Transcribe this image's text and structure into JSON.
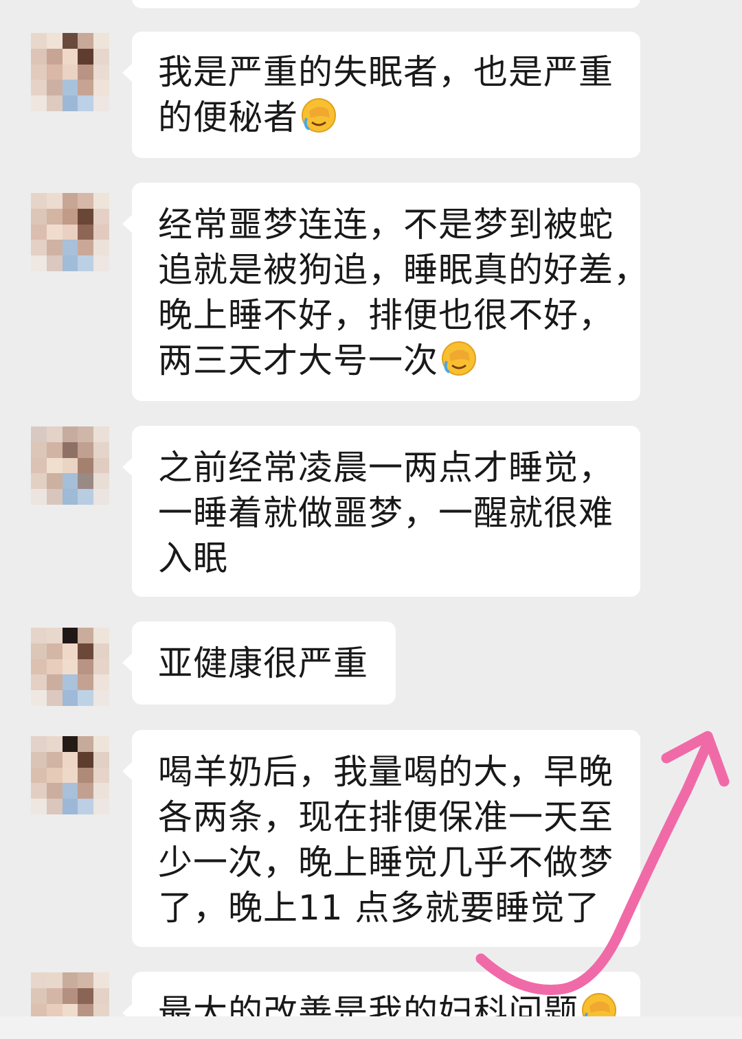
{
  "chat": {
    "messages": [
      {
        "lines": [
          "我是严重的失眠者，也是严重",
          "的便秘者"
        ],
        "emoji": "face-palm-emoji"
      },
      {
        "lines": [
          "经常噩梦连连，不是梦到被蛇",
          "追就是被狗追，睡眠真的好差，",
          "晚上睡不好，排便也很不好，",
          "两三天才大号一次"
        ],
        "emoji": "face-palm-emoji"
      },
      {
        "lines": [
          "之前经常凌晨一两点才睡觉，",
          "一睡着就做噩梦，一醒就很难",
          "入眠"
        ]
      },
      {
        "lines": [
          "亚健康很严重"
        ]
      },
      {
        "lines": [
          "喝羊奶后，我量喝的大，早晚",
          "各两条，现在排便保准一天至",
          "少一次，晚上睡觉几乎不做梦",
          "了，晚上11 点多就要睡觉了"
        ]
      },
      {
        "lines": [
          "最大的改善是我的妇科问题"
        ],
        "emoji": "face-palm-emoji"
      }
    ]
  },
  "colors": {
    "background": "#ededed",
    "bubble": "#ffffff",
    "text": "#191919",
    "arrow": "#f06aa8"
  },
  "icons": {
    "annotation": "pink-curved-arrow-icon",
    "avatar": "pixelated-avatar"
  }
}
